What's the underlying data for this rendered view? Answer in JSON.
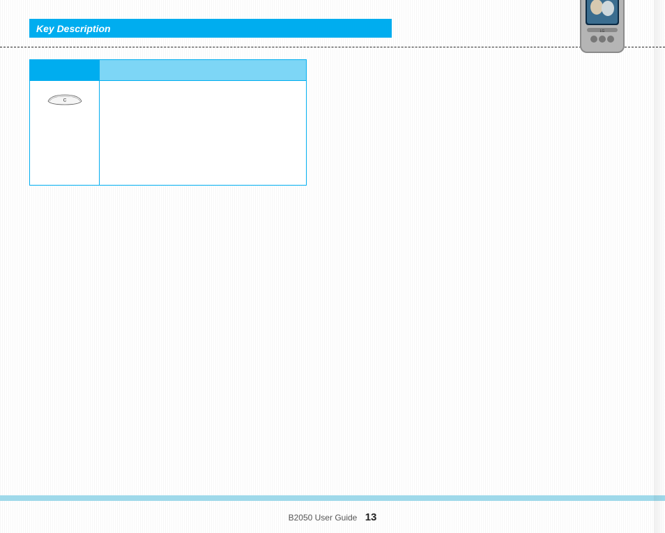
{
  "section": {
    "title": "Key Description"
  },
  "table": {
    "headers": {
      "key": "",
      "description": ""
    },
    "rows": [
      {
        "key_label": "C",
        "description": ""
      }
    ]
  },
  "footer": {
    "guide": "B2050 User Guide",
    "page": "13"
  }
}
